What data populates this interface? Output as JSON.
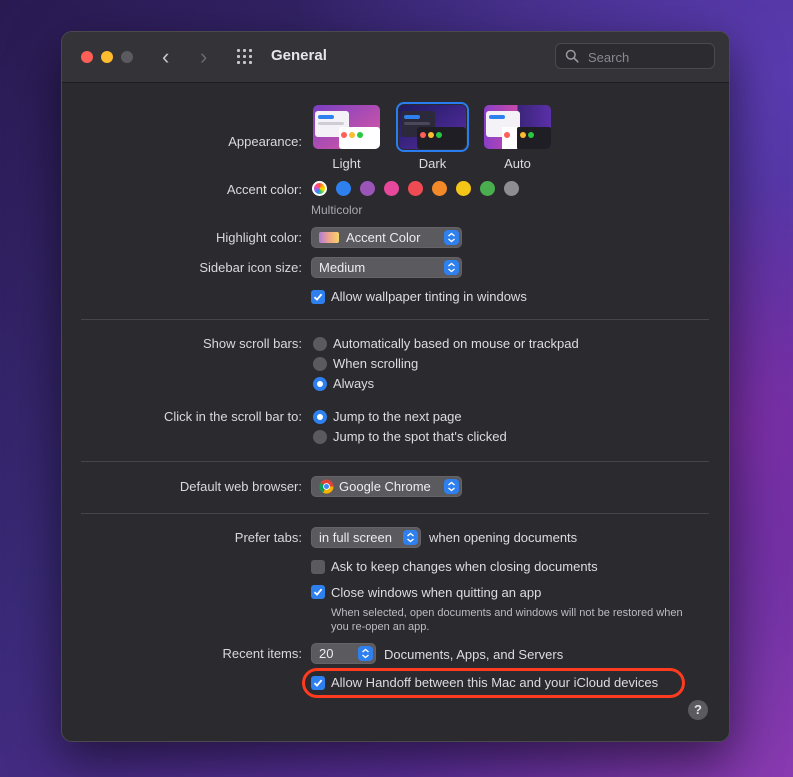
{
  "window": {
    "title": "General"
  },
  "search": {
    "placeholder": "Search"
  },
  "appearance": {
    "label": "Appearance:",
    "options": [
      "Light",
      "Dark",
      "Auto"
    ],
    "selected": "Dark"
  },
  "accent": {
    "label": "Accent color:",
    "selected_name": "Multicolor",
    "colors": [
      "#ffffff",
      "#2f80ef",
      "#9b55b9",
      "#e7489b",
      "#ef4b55",
      "#f28a2a",
      "#f5c518",
      "#4aae4f",
      "#8e8d92"
    ]
  },
  "highlight": {
    "label": "Highlight color:",
    "value": "Accent Color"
  },
  "sidebar_size": {
    "label": "Sidebar icon size:",
    "value": "Medium"
  },
  "wallpaper_tint": {
    "label": "Allow wallpaper tinting in windows",
    "checked": true
  },
  "scroll_bars": {
    "label": "Show scroll bars:",
    "options": [
      "Automatically based on mouse or trackpad",
      "When scrolling",
      "Always"
    ],
    "selected": "Always"
  },
  "scroll_click": {
    "label": "Click in the scroll bar to:",
    "options": [
      "Jump to the next page",
      "Jump to the spot that's clicked"
    ],
    "selected": "Jump to the next page"
  },
  "browser": {
    "label": "Default web browser:",
    "value": "Google Chrome"
  },
  "prefer_tabs": {
    "label": "Prefer tabs:",
    "value": "in full screen",
    "suffix": "when opening documents"
  },
  "ask_keep": {
    "label": "Ask to keep changes when closing documents",
    "checked": false
  },
  "close_windows": {
    "label": "Close windows when quitting an app",
    "checked": true,
    "note": "When selected, open documents and windows will not be restored when you re-open an app."
  },
  "recent": {
    "label": "Recent items:",
    "value": "20",
    "suffix": "Documents, Apps, and Servers"
  },
  "handoff": {
    "label": "Allow Handoff between this Mac and your iCloud devices",
    "checked": true
  },
  "help": {
    "label": "?"
  }
}
